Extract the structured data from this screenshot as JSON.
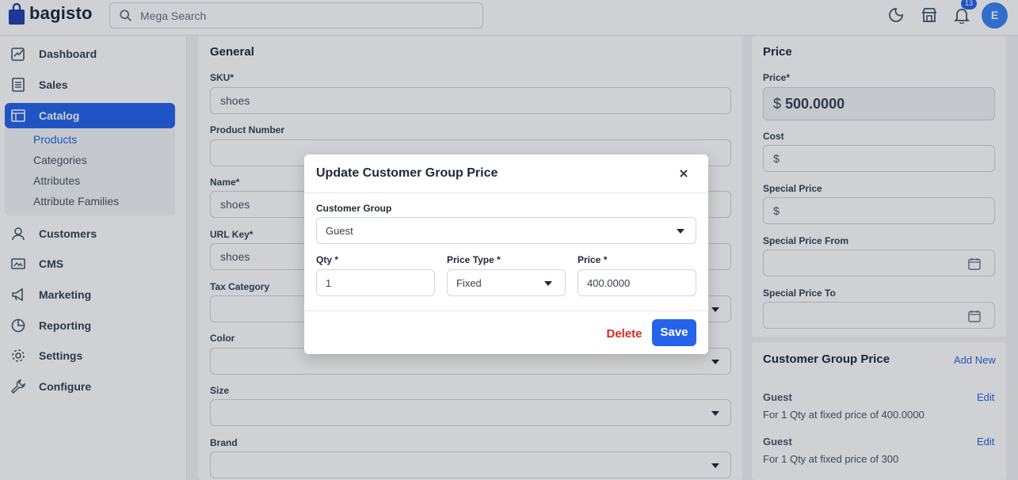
{
  "header": {
    "brand": "bagisto",
    "search_placeholder": "Mega Search",
    "notification_count": "13",
    "avatar_initial": "E"
  },
  "sidebar": {
    "items": [
      {
        "label": "Dashboard",
        "icon": "dashboard-icon"
      },
      {
        "label": "Sales",
        "icon": "sales-icon"
      },
      {
        "label": "Catalog",
        "icon": "catalog-icon"
      },
      {
        "label": "Customers",
        "icon": "customers-icon"
      },
      {
        "label": "CMS",
        "icon": "cms-icon"
      },
      {
        "label": "Marketing",
        "icon": "marketing-icon"
      },
      {
        "label": "Reporting",
        "icon": "reporting-icon"
      },
      {
        "label": "Settings",
        "icon": "settings-icon"
      },
      {
        "label": "Configure",
        "icon": "configure-icon"
      }
    ],
    "catalog_submenu": [
      "Products",
      "Categories",
      "Attributes",
      "Attribute Families"
    ]
  },
  "general": {
    "title": "General",
    "sku_label": "SKU*",
    "sku_value": "shoes",
    "product_number_label": "Product Number",
    "name_label": "Name*",
    "name_value": "shoes",
    "url_key_label": "URL Key*",
    "url_key_value": "shoes",
    "tax_category_label": "Tax Category",
    "color_label": "Color",
    "size_label": "Size",
    "brand_label": "Brand"
  },
  "price": {
    "title": "Price",
    "price_label": "Price*",
    "currency": "$",
    "price_value": "500.0000",
    "cost_label": "Cost",
    "special_price_label": "Special Price",
    "special_price_from_label": "Special Price From",
    "special_price_to_label": "Special Price To"
  },
  "customer_group_price": {
    "title": "Customer Group Price",
    "add_new": "Add New",
    "entries": [
      {
        "group": "Guest",
        "edit": "Edit",
        "desc": "For 1 Qty at fixed price of 400.0000"
      },
      {
        "group": "Guest",
        "edit": "Edit",
        "desc": "For 1 Qty at fixed price of 300"
      }
    ]
  },
  "modal": {
    "title": "Update Customer Group Price",
    "customer_group_label": "Customer Group",
    "customer_group_value": "Guest",
    "qty_label": "Qty *",
    "qty_value": "1",
    "price_type_label": "Price Type *",
    "price_type_value": "Fixed",
    "price_label": "Price *",
    "price_value": "400.0000",
    "delete_label": "Delete",
    "save_label": "Save"
  },
  "colors": {
    "accent": "#2563eb",
    "danger": "#dc2626"
  }
}
